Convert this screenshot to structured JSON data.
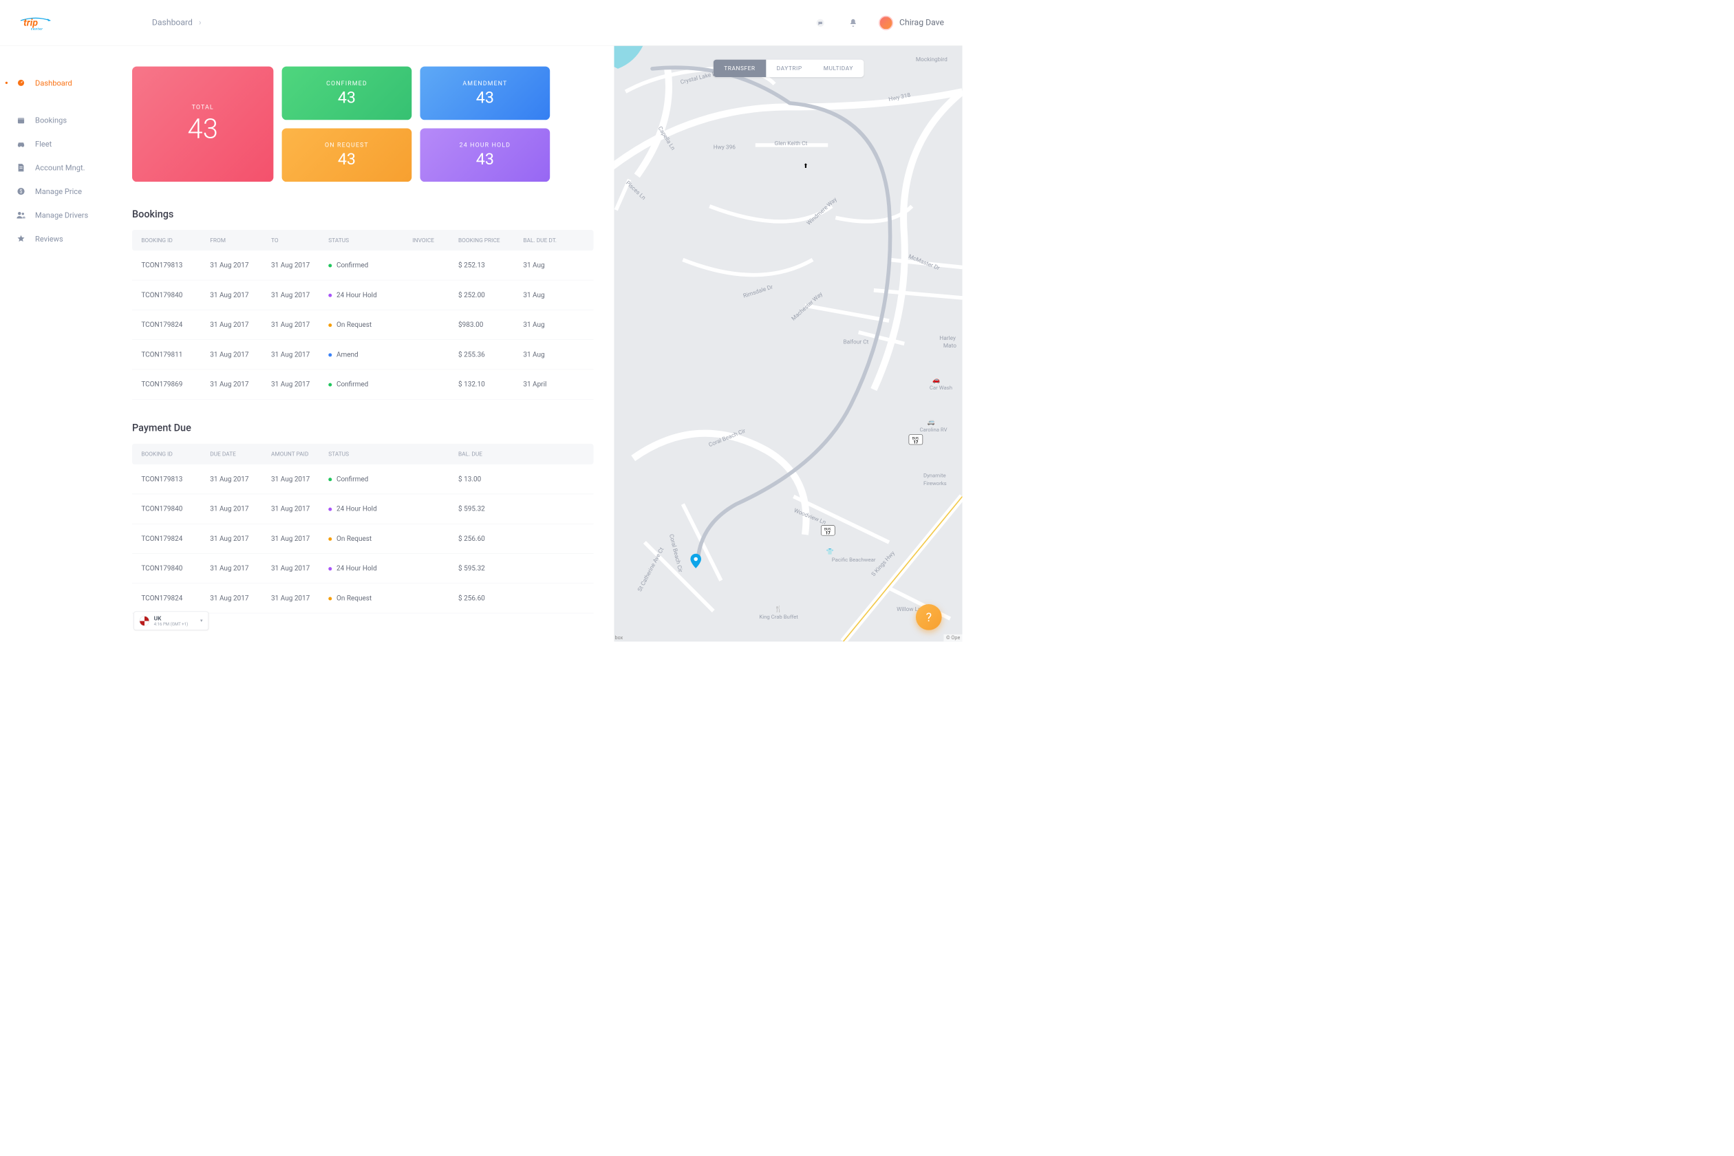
{
  "header": {
    "breadcrumb": "Dashboard",
    "username": "Chirag Dave"
  },
  "sidebar": {
    "items": [
      {
        "label": "Dashboard",
        "icon": "dashboard"
      },
      {
        "label": "Bookings",
        "icon": "calendar"
      },
      {
        "label": "Fleet",
        "icon": "car"
      },
      {
        "label": "Account Mngt.",
        "icon": "doc"
      },
      {
        "label": "Manage Price",
        "icon": "dollar"
      },
      {
        "label": "Manage Drivers",
        "icon": "people"
      },
      {
        "label": "Reviews",
        "icon": "star"
      }
    ]
  },
  "cards": {
    "total": {
      "label": "TOTAL",
      "value": "43"
    },
    "confirmed": {
      "label": "CONFIRMED",
      "value": "43"
    },
    "amendment": {
      "label": "AMENDMENT",
      "value": "43"
    },
    "onrequest": {
      "label": "ON REQUEST",
      "value": "43"
    },
    "hold": {
      "label": "24 HOUR HOLD",
      "value": "43"
    }
  },
  "bookings": {
    "title": "Bookings",
    "headers": {
      "id": "BOOKING ID",
      "from": "FROM",
      "to": "TO",
      "status": "STATUS",
      "invoice": "INVOICE",
      "price": "BOOKING PRICE",
      "due": "BAL. DUE DT."
    },
    "rows": [
      {
        "id": "TCON179813",
        "from": "31 Aug 2017",
        "to": "31 Aug 2017",
        "status": "Confirmed",
        "status_kind": "confirmed",
        "invoice": "",
        "price": "$ 252.13",
        "due": "31 Aug"
      },
      {
        "id": "TCON179840",
        "from": "31 Aug 2017",
        "to": "31 Aug 2017",
        "status": "24 Hour Hold",
        "status_kind": "hold",
        "invoice": "",
        "price": "$ 252.00",
        "due": "31 Aug"
      },
      {
        "id": "TCON179824",
        "from": "31 Aug 2017",
        "to": "31 Aug 2017",
        "status": "On Request",
        "status_kind": "request",
        "invoice": "",
        "price": "$983.00",
        "due": "31 Aug"
      },
      {
        "id": "TCON179811",
        "from": "31 Aug 2017",
        "to": "31 Aug 2017",
        "status": "Amend",
        "status_kind": "amend",
        "invoice": "",
        "price": "$ 255.36",
        "due": "31 Aug"
      },
      {
        "id": "TCON179869",
        "from": "31 Aug 2017",
        "to": "31 Aug 2017",
        "status": "Confirmed",
        "status_kind": "confirmed",
        "invoice": "",
        "price": "$ 132.10",
        "due": "31 April"
      }
    ]
  },
  "payments": {
    "title": "Payment Due",
    "headers": {
      "id": "BOOKING ID",
      "duedate": "DUE DATE",
      "paid": "AMOUNT PAID",
      "status": "STATUS",
      "baldue": "BAL. DUE"
    },
    "rows": [
      {
        "id": "TCON179813",
        "duedate": "31 Aug 2017",
        "paid": "31 Aug 2017",
        "status": "Confirmed",
        "status_kind": "confirmed",
        "baldue": "$ 13.00"
      },
      {
        "id": "TCON179840",
        "duedate": "31 Aug 2017",
        "paid": "31 Aug 2017",
        "status": "24 Hour Hold",
        "status_kind": "hold",
        "baldue": "$ 595.32"
      },
      {
        "id": "TCON179824",
        "duedate": "31 Aug 2017",
        "paid": "31 Aug 2017",
        "status": "On Request",
        "status_kind": "request",
        "baldue": "$ 256.60"
      },
      {
        "id": "TCON179840",
        "duedate": "31 Aug 2017",
        "paid": "31 Aug 2017",
        "status": "24 Hour Hold",
        "status_kind": "hold",
        "baldue": "$ 595.32"
      },
      {
        "id": "TCON179824",
        "duedate": "31 Aug 2017",
        "paid": "31 Aug 2017",
        "status": "On Request",
        "status_kind": "request",
        "baldue": "$ 256.60"
      }
    ]
  },
  "map": {
    "tabs": [
      {
        "label": "TRANSFER"
      },
      {
        "label": "DAYTRIP"
      },
      {
        "label": "MULTIDAY"
      }
    ],
    "labels": [
      "Crystal Lake Dr",
      "Capella Ln",
      "Pisces Ln",
      "Hwy 396",
      "Glen Keith Ct",
      "Hwy 318",
      "Mockingbird",
      "Windmere Way",
      "McMaster Dr",
      "Rimsdale Dr",
      "Machester Way",
      "Balfour Ct",
      "Harley Mato",
      "Coral Beach Cir",
      "Woodview Ln",
      "St Catherine Ave Ct",
      "S Kings Hwy",
      "Willow Ln",
      "Coral Beach Cir"
    ],
    "pois": [
      "Carolina RV",
      "Dynamite Fireworks",
      "Car Wash",
      "Pacific Beachwear",
      "King Crab Buffet"
    ],
    "shields": [
      "BUS. 17",
      "BUS. 17"
    ],
    "attrib": "© Ope",
    "bl_logo": "box"
  },
  "region": {
    "name": "UK",
    "time": "4:16 PM (GMT +1)"
  },
  "fab": "?"
}
